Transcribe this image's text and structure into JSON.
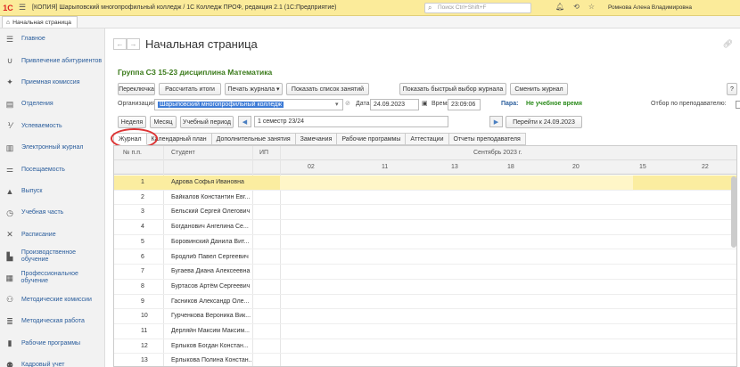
{
  "titlebar": {
    "logo": "1С",
    "title": "[КОПИЯ] Шарыповский многопрофильный колледж / 1С Колледж ПРОФ, редакция 2.1  (1С:Предприятие)",
    "search_placeholder": "Поиск Ctrl+Shift+F",
    "user": "Ромнова Алена Владимировна"
  },
  "tabs": {
    "home": "Начальная страница"
  },
  "sidebar": {
    "items": [
      {
        "icon": "menu-icon",
        "label": "Главное"
      },
      {
        "icon": "magnet-icon",
        "label": "Привлечение абитуриентов"
      },
      {
        "icon": "admission-icon",
        "label": "Приемная комиссия"
      },
      {
        "icon": "department-icon",
        "label": "Отделения"
      },
      {
        "icon": "grades-icon",
        "label": "Успеваемость"
      },
      {
        "icon": "journal-icon",
        "label": "Электронный журнал"
      },
      {
        "icon": "attendance-icon",
        "label": "Посещаемость"
      },
      {
        "icon": "graduation-icon",
        "label": "Выпуск"
      },
      {
        "icon": "clock-icon",
        "label": "Учебная часть"
      },
      {
        "icon": "schedule-icon",
        "label": "Расписание"
      },
      {
        "icon": "factory-icon",
        "label": "Производственное обучение"
      },
      {
        "icon": "briefcase-icon",
        "label": "Профессиональное обучение"
      },
      {
        "icon": "people-icon",
        "label": "Методические комиссии"
      },
      {
        "icon": "method-icon",
        "label": "Методическая работа"
      },
      {
        "icon": "book-icon",
        "label": "Рабочие программы"
      },
      {
        "icon": "hr-icon",
        "label": "Кадровый учет"
      }
    ]
  },
  "main": {
    "page_title": "Начальная страница",
    "group_title": "Группа СЗ 15-23 дисциплина Математика",
    "buttons": {
      "switch": "Переключка",
      "calc": "Рассчитать итоги",
      "print": "Печать журнала ▾",
      "list": "Показать список занятий",
      "quick": "Показать быстрый выбор журнала",
      "change": "Сменить журнал",
      "help": "?",
      "week": "Неделя",
      "month": "Месяц",
      "period": "Учебный период",
      "goto": "Перейти к 24.09.2023"
    },
    "org_label": "Организация:",
    "org_value": "Шарыповский многопрофильный колледж",
    "date_label": "Дата:",
    "date_value": "24.09.2023",
    "time_label": "Время:",
    "time_value": "23:09:06",
    "pair_label": "Пара:",
    "pair_value": "Не учебное время",
    "teacher_filter_label": "Отбор по преподавателю:",
    "semester": "1 семестр 23/24",
    "content_tabs": [
      "Журнал",
      "Календарный план",
      "Дополнительные занятия",
      "Замечания",
      "Рабочие программы",
      "Аттестации",
      "Отчеты преподавателя"
    ],
    "grid": {
      "headers": {
        "num": "№ п.п.",
        "student": "Студент",
        "ip": "ИП",
        "month": "Сентябрь 2023 г."
      },
      "days": [
        "02",
        "11",
        "13",
        "18",
        "20",
        "15",
        "22"
      ],
      "rows": [
        {
          "n": "1",
          "name": "Адрова Софья Ивановна"
        },
        {
          "n": "2",
          "name": "Байкалов Константин Евг..."
        },
        {
          "n": "3",
          "name": "Бельский Сергей Олегович"
        },
        {
          "n": "4",
          "name": "Богданович Ангелина Се..."
        },
        {
          "n": "5",
          "name": "Боровинский Данила Вит..."
        },
        {
          "n": "6",
          "name": "Бродлиб Павел Сергеевич"
        },
        {
          "n": "7",
          "name": "Бугаева Диана Алексеевна"
        },
        {
          "n": "8",
          "name": "Буртасов Артём Сергеевич"
        },
        {
          "n": "9",
          "name": "Гасников Александр Оле..."
        },
        {
          "n": "10",
          "name": "Гурченкова Вероника Вик..."
        },
        {
          "n": "11",
          "name": "Дерляйн Максим Максим..."
        },
        {
          "n": "12",
          "name": "Ерлыков Богдан Констан..."
        },
        {
          "n": "13",
          "name": "Ерлыкова Полина Констан..."
        }
      ]
    }
  }
}
